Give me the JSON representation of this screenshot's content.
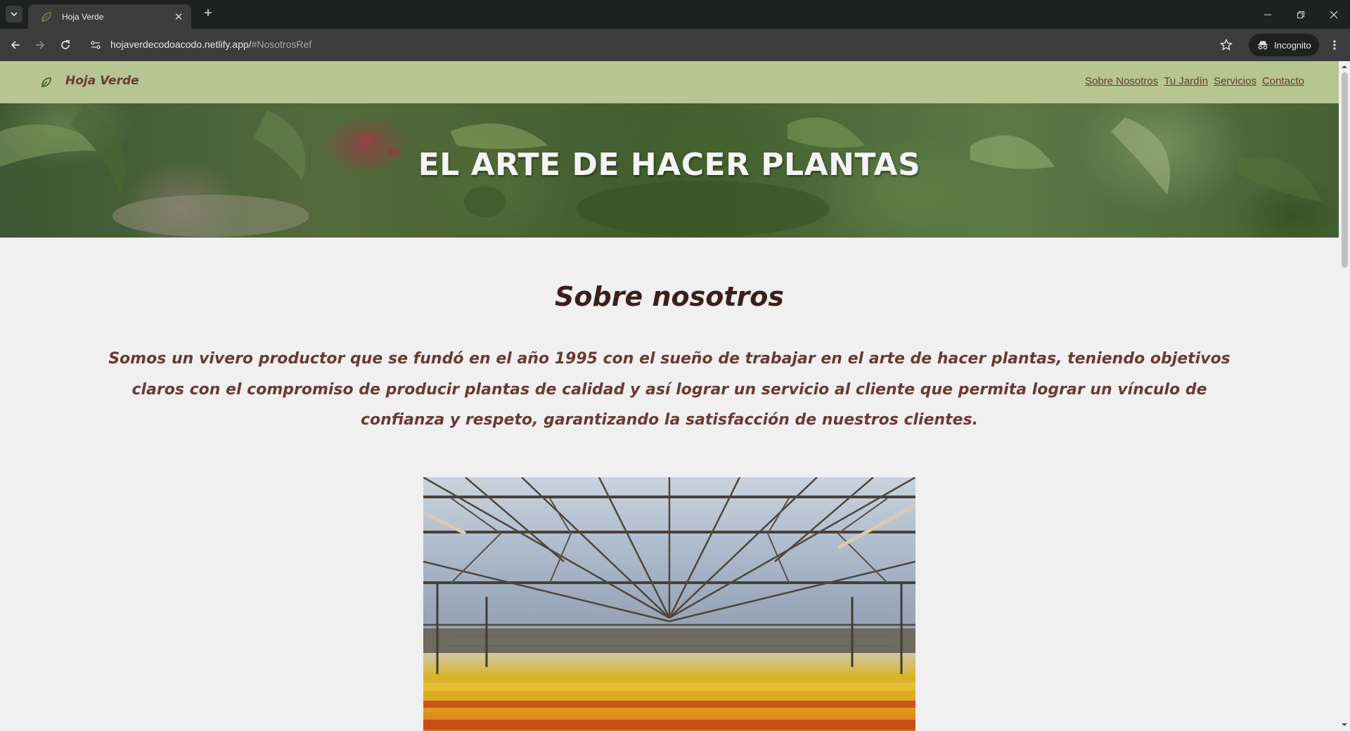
{
  "browser": {
    "tab_title": "Hoja Verde",
    "url_host": "hojaverdecodoacodo.netlify.app/",
    "url_path": "#NosotrosRef",
    "incognito_label": "Incognito",
    "icons": [
      "tab-search-icon",
      "leaf-favicon",
      "close-icon",
      "plus-icon",
      "back-arrow-icon",
      "forward-arrow-icon",
      "reload-icon",
      "site-info-icon",
      "star-icon",
      "incognito-icon",
      "kebab-menu-icon",
      "minimize-icon",
      "restore-icon",
      "close-window-icon"
    ]
  },
  "site": {
    "brand": "Hoja Verde",
    "nav": [
      "Sobre Nosotros",
      "Tu Jardín",
      "Servicios",
      "Contacto"
    ],
    "hero_title": "EL ARTE DE HACER PLANTAS",
    "about": {
      "title": "Sobre nosotros",
      "text": "Somos un vivero productor que se fundó en el año 1995 con el sueño de trabajar en el arte de hacer plantas, teniendo objetivos claros con el compromiso de producir plantas de calidad y así lograr un servicio al cliente que permita lograr un vínculo de confianza y respeto, garantizando la satisfacción de nuestros clientes."
    }
  },
  "colors": {
    "header_bg": "#b6c591",
    "brand_text": "#6b3a33",
    "title_text": "#3b201a",
    "page_bg": "#f0f0f0"
  }
}
